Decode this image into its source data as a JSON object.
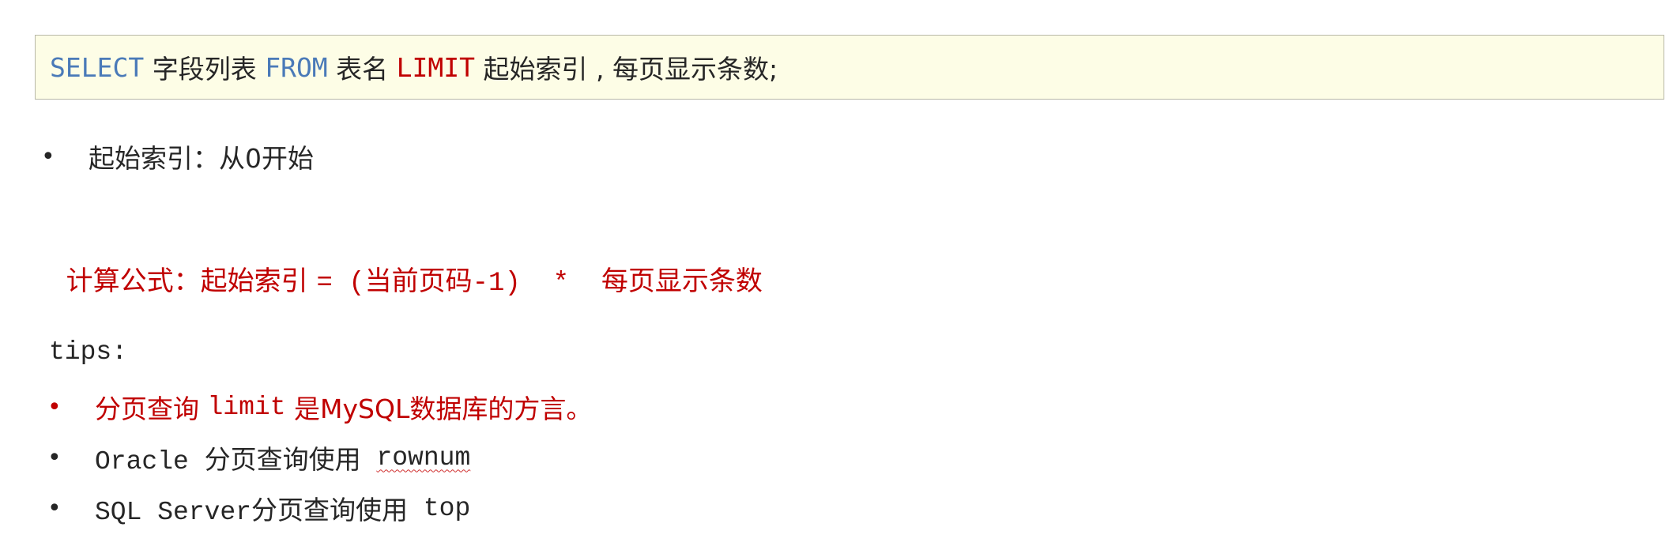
{
  "code": {
    "kw_select": "SELECT",
    "fields": " 字段列表 ",
    "kw_from": "FROM",
    "table": " 表名 ",
    "kw_limit": "LIMIT",
    "rest": " 起始索引 , 每页显示条数;"
  },
  "note": {
    "bullet": "•",
    "text": "起始索引：从0开始"
  },
  "formula": {
    "label": "计算公式：起始索引 ",
    "expr": "= (当前页码-1)  *  ",
    "tail": "每页显示条数"
  },
  "tips": {
    "title": "tips:",
    "items": [
      {
        "bullet": "•",
        "pre": "分页查询 ",
        "code": "limit",
        "post": " 是MySQL数据库的方言。"
      },
      {
        "bullet": "•",
        "pre": "Oracle 分页查询使用 ",
        "code": "rownum"
      },
      {
        "bullet": "•",
        "pre": "SQL Server分页查询使用 ",
        "code": "top"
      }
    ]
  },
  "colors": {
    "keyword_blue": "#4a7ab8",
    "keyword_red": "#c00000",
    "code_bg": "#fdfde6"
  }
}
